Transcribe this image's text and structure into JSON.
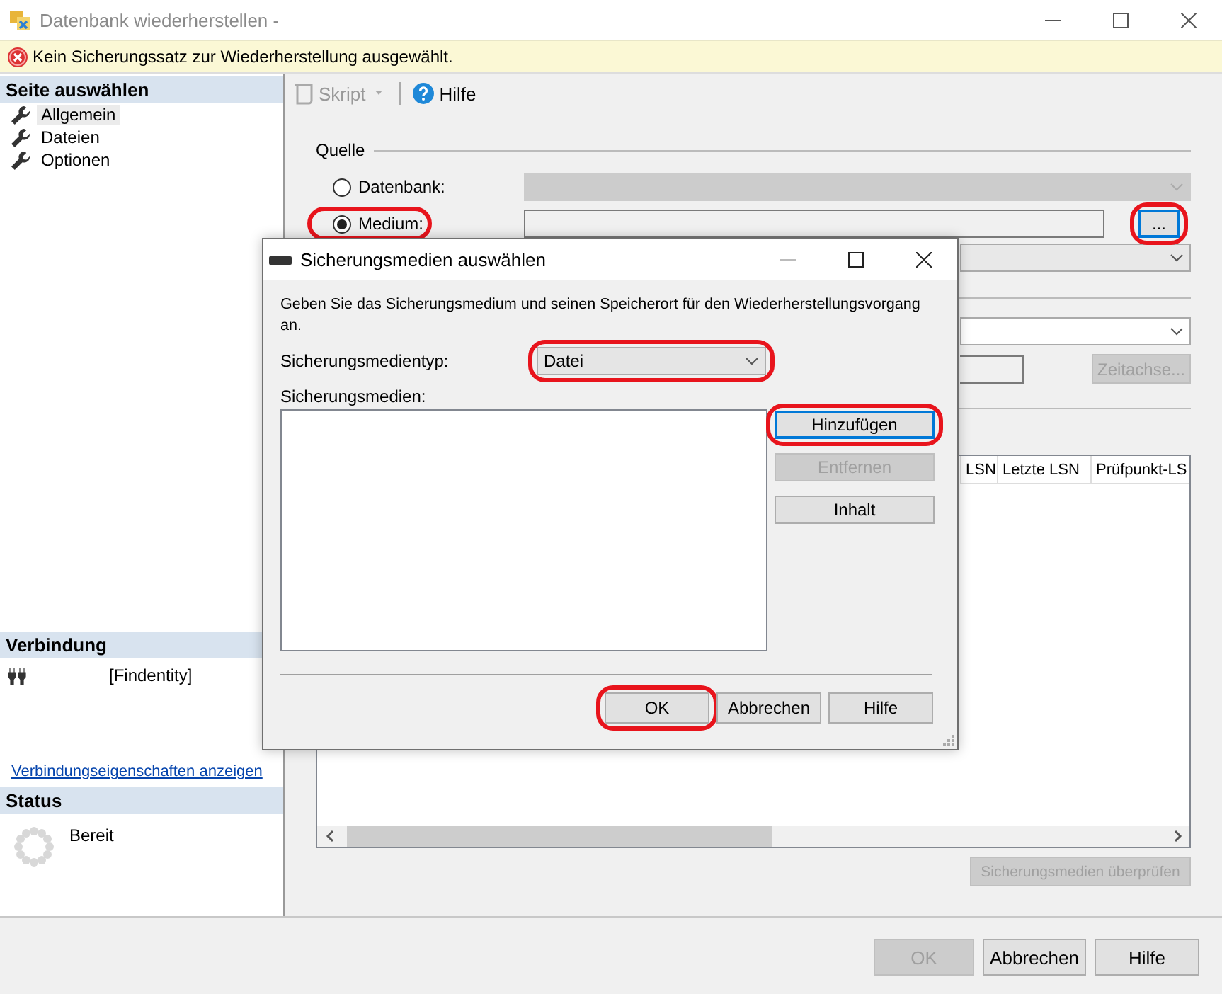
{
  "window": {
    "title": "Datenbank wiederherstellen -"
  },
  "error_bar": {
    "message": "Kein Sicherungssatz zur Wiederherstellung ausgewählt."
  },
  "page_select": {
    "heading": "Seite auswählen",
    "items": [
      {
        "label": "Allgemein",
        "selected": true
      },
      {
        "label": "Dateien",
        "selected": false
      },
      {
        "label": "Optionen",
        "selected": false
      }
    ]
  },
  "connection": {
    "heading": "Verbindung",
    "server": "[Findentity]",
    "link": "Verbindungseigenschaften anzeigen"
  },
  "status": {
    "heading": "Status",
    "text": "Bereit"
  },
  "toolbar": {
    "items": [
      {
        "kind": "script",
        "label": "Skript",
        "disabled": true
      },
      {
        "kind": "help",
        "label": "Hilfe",
        "disabled": false
      }
    ]
  },
  "source": {
    "legend": "Quelle",
    "options": [
      {
        "kind": "database",
        "label": "Datenbank:",
        "selected": false,
        "highlighted": false
      },
      {
        "kind": "device",
        "label": "Medium:",
        "selected": true,
        "highlighted": true
      }
    ],
    "browse_button": {
      "label": "...",
      "highlighted": true
    }
  },
  "timeline_button": {
    "label": "Zeitachse...",
    "disabled": true
  },
  "backup_table": {
    "columns": [
      "LSN",
      "Letzte LSN",
      "Prüfpunkt-LS"
    ]
  },
  "verify_button": {
    "label": "Sicherungsmedien überprüfen",
    "disabled": true
  },
  "footer_buttons": [
    {
      "label": "OK",
      "disabled": true
    },
    {
      "label": "Abbrechen",
      "disabled": false
    },
    {
      "label": "Hilfe",
      "disabled": false
    }
  ],
  "dialog": {
    "title": "Sicherungsmedien auswählen",
    "instruction": "Geben Sie das Sicherungsmedium und seinen Speicherort für den Wiederherstellungsvorgang an.",
    "media_type": {
      "label": "Sicherungsmedientyp:",
      "value": "Datei",
      "highlighted": true
    },
    "media_list_label": "Sicherungsmedien:",
    "side_buttons": [
      {
        "label": "Hinzufügen",
        "disabled": false,
        "focused": true,
        "highlighted": true
      },
      {
        "label": "Entfernen",
        "disabled": true,
        "focused": false,
        "highlighted": false
      },
      {
        "label": "Inhalt",
        "disabled": false,
        "focused": false,
        "highlighted": false
      }
    ],
    "buttons": [
      {
        "label": "OK",
        "disabled": false,
        "highlighted": true
      },
      {
        "label": "Abbrechen",
        "disabled": false,
        "highlighted": false
      },
      {
        "label": "Hilfe",
        "disabled": false,
        "highlighted": false
      }
    ]
  }
}
